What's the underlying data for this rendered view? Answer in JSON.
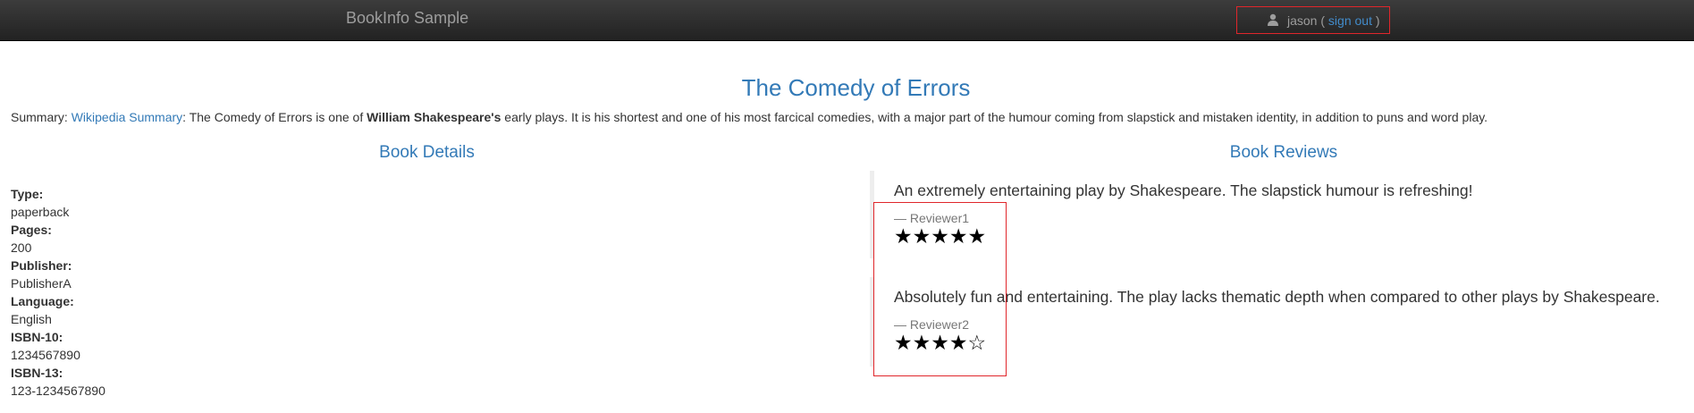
{
  "app": {
    "brand": "BookInfo Sample"
  },
  "user": {
    "name": "jason",
    "open_paren": "(",
    "sign_out_label": "sign out",
    "close_paren": ")"
  },
  "book": {
    "title": "The Comedy of Errors",
    "summary_prefix": "Summary: ",
    "summary_link": "Wikipedia Summary",
    "summary_text_1": ": The Comedy of Errors is one of ",
    "summary_bold": "William Shakespeare's",
    "summary_text_2": " early plays. It is his shortest and one of his most farcical comedies, with a major part of the humour coming from slapstick and mistaken identity, in addition to puns and word play."
  },
  "details": {
    "heading": "Book Details",
    "fields": [
      {
        "label": "Type:",
        "value": "paperback"
      },
      {
        "label": "Pages:",
        "value": "200"
      },
      {
        "label": "Publisher:",
        "value": "PublisherA"
      },
      {
        "label": "Language:",
        "value": "English"
      },
      {
        "label": "ISBN-10:",
        "value": "1234567890"
      },
      {
        "label": "ISBN-13:",
        "value": "123-1234567890"
      }
    ]
  },
  "reviews": {
    "heading": "Book Reviews",
    "items": [
      {
        "text": "An extremely entertaining play by Shakespeare. The slapstick humour is refreshing!",
        "reviewer": "— Reviewer1",
        "rating": 5,
        "stars": "★★★★★"
      },
      {
        "text": "Absolutely fun and entertaining. The play lacks thematic depth when compared to other plays by Shakespeare.",
        "reviewer": "— Reviewer2",
        "rating": 4,
        "stars": "★★★★☆"
      }
    ]
  },
  "colors": {
    "link": "#337ab7",
    "navbar": "#222222",
    "highlight": "#e0262b",
    "star": "#000000"
  }
}
